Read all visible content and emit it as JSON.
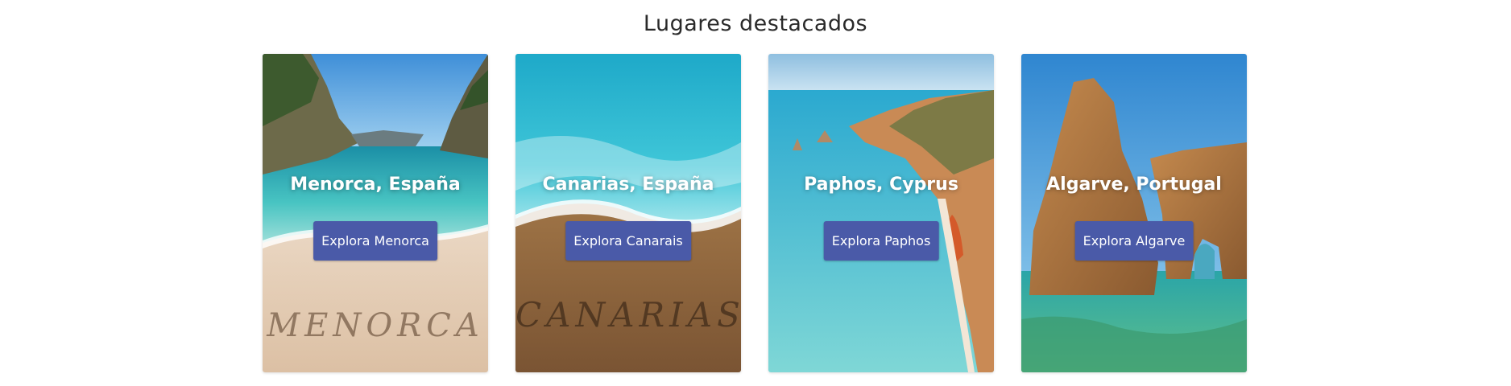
{
  "section": {
    "title": "Lugares destacados"
  },
  "cards": [
    {
      "title": "Menorca, España",
      "button": "Explora Menorca",
      "sand_text": "MENORCA"
    },
    {
      "title": "Canarias, España",
      "button": "Explora Canarais",
      "sand_text": "CANARIAS"
    },
    {
      "title": "Paphos, Cyprus",
      "button": "Explora Paphos"
    },
    {
      "title": "Algarve, Portugal",
      "button": "Explora Algarve"
    }
  ],
  "colors": {
    "button_bg": "#4a5aa8",
    "title_text": "#2a2a2a",
    "card_text": "#ffffff"
  }
}
